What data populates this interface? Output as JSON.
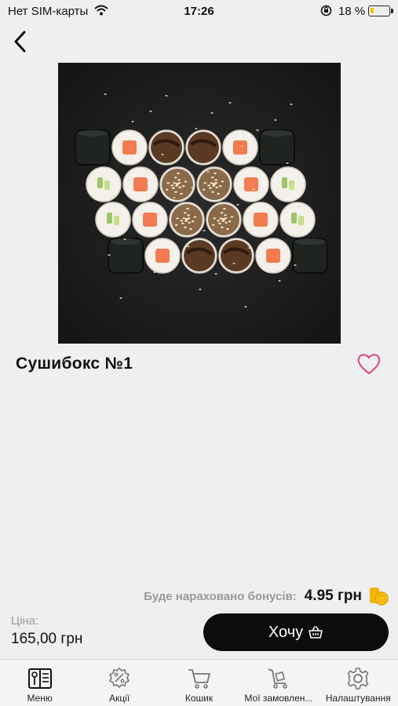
{
  "status_bar": {
    "carrier": "Нет SIM-карты",
    "time": "17:26",
    "battery": "18 %",
    "battery_level": 0.18
  },
  "nav": {
    "back_icon": "chevron-left-icon"
  },
  "product": {
    "image_icon": "sushi-photo",
    "title": "Сушибокс №1",
    "favorite_icon": "heart-outline-icon"
  },
  "bonus": {
    "label": "Буде нараховано бонусів:",
    "value": "4.95 грн",
    "icon": "coins-icon"
  },
  "price": {
    "label": "Ціна:",
    "value": "165,00 грн"
  },
  "action": {
    "want_label": "Хочу",
    "want_icon": "basket-icon"
  },
  "tabs": [
    {
      "label": "Меню",
      "icon": "menu-book-icon",
      "active": true
    },
    {
      "label": "Акції",
      "icon": "discount-icon",
      "active": false
    },
    {
      "label": "Кошик",
      "icon": "cart-icon",
      "active": false
    },
    {
      "label": "Мої замовлен...",
      "icon": "orders-icon",
      "active": false
    },
    {
      "label": "Налаштування",
      "icon": "gear-icon",
      "active": false
    }
  ],
  "colors": {
    "accent_heart": "#e0457b",
    "coin": "#f4b400",
    "button_bg": "#0c0c0c",
    "background": "#efefef"
  }
}
